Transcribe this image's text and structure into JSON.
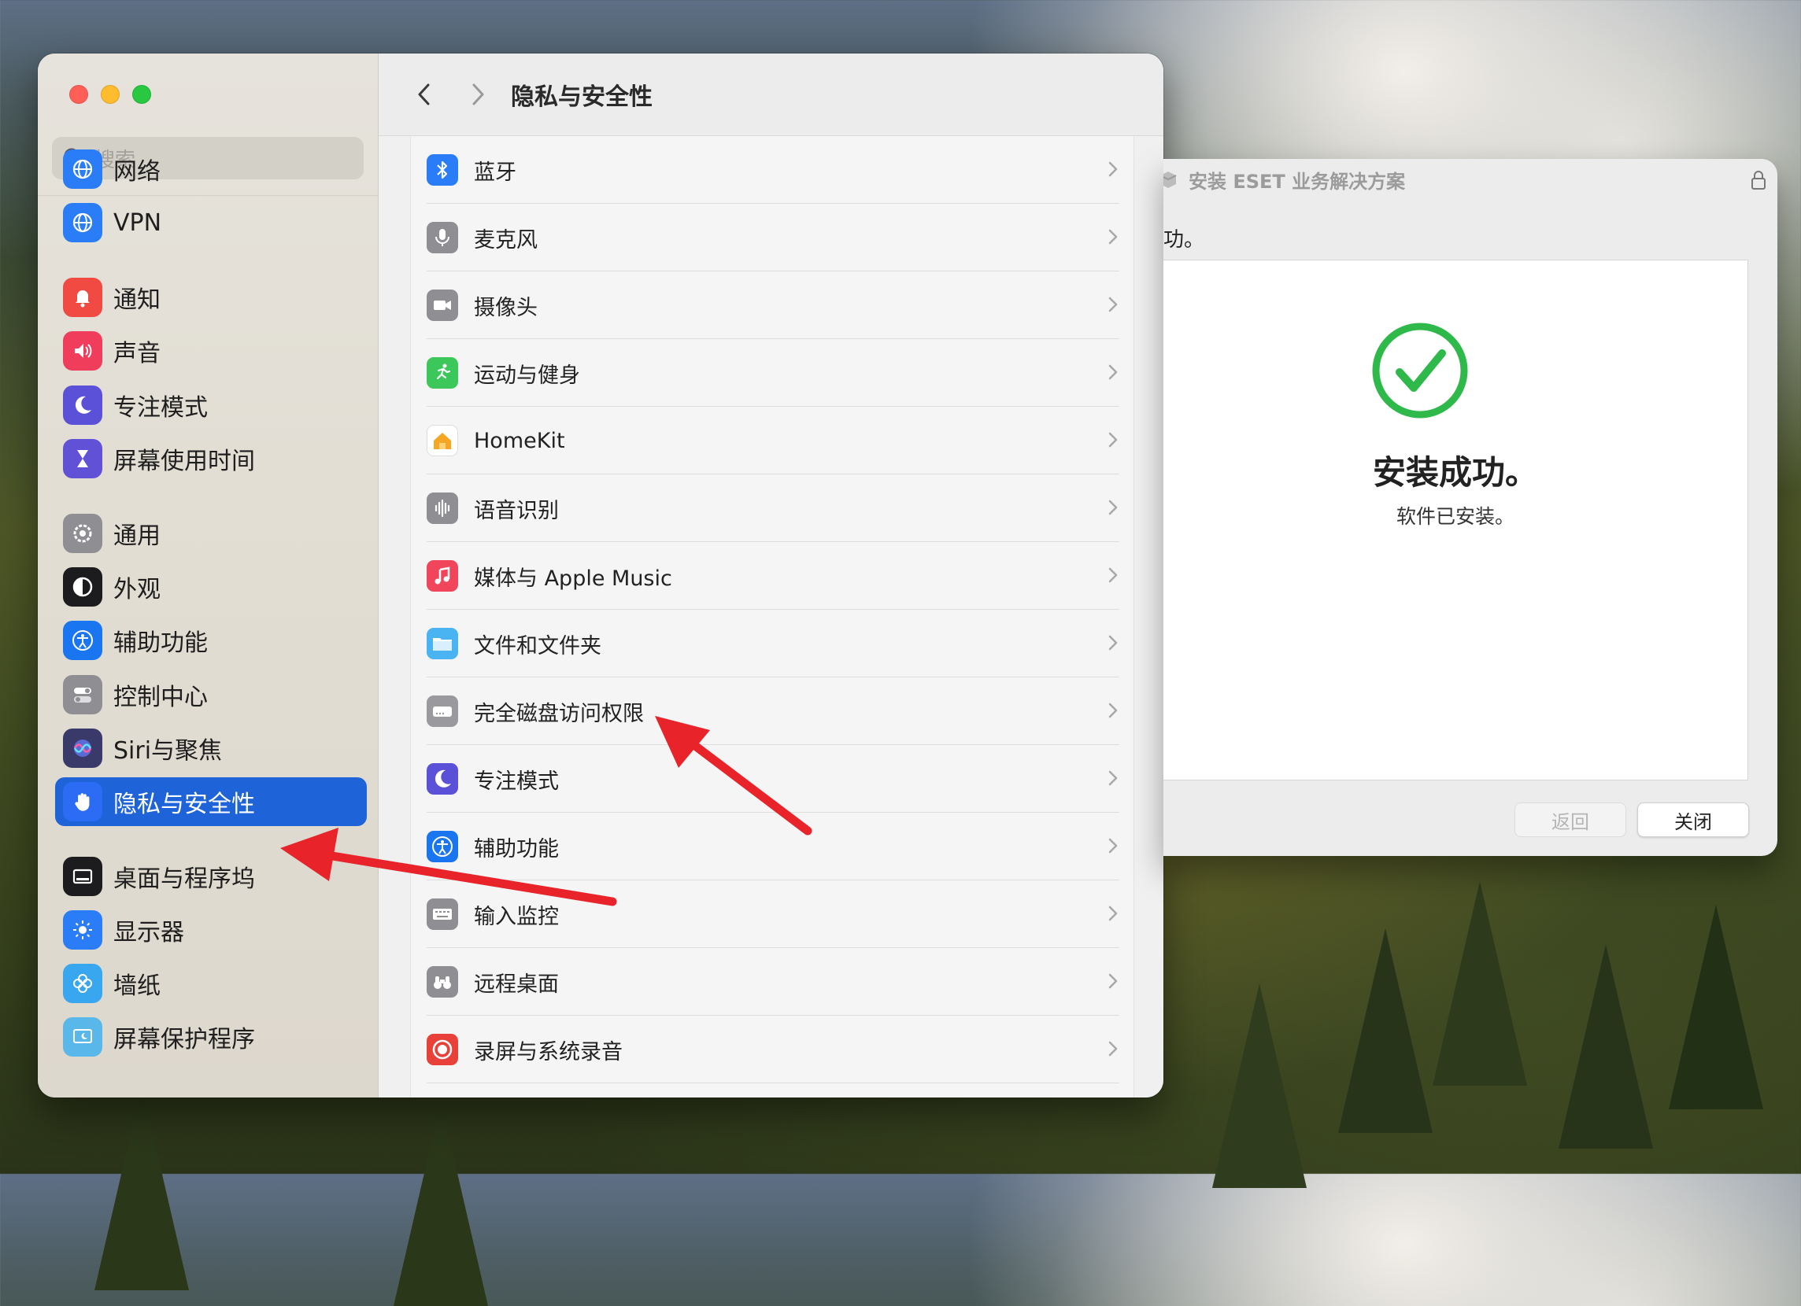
{
  "settings": {
    "search_placeholder": "搜索",
    "title": "隐私与安全性",
    "sidebar": [
      {
        "label": "网络",
        "icon": "globe-icon",
        "color": "#2a7cf7"
      },
      {
        "label": "VPN",
        "icon": "globe-vpn-icon",
        "color": "#2a7cf7"
      },
      {
        "label": "通知",
        "icon": "bell-icon",
        "color": "#f04a43"
      },
      {
        "label": "声音",
        "icon": "speaker-icon",
        "color": "#ef3d5b"
      },
      {
        "label": "专注模式",
        "icon": "moon-icon",
        "color": "#5b51d8"
      },
      {
        "label": "屏幕使用时间",
        "icon": "hourglass-icon",
        "color": "#6151d6"
      },
      {
        "label": "通用",
        "icon": "gear-icon",
        "color": "#8e8e93"
      },
      {
        "label": "外观",
        "icon": "appearance-icon",
        "color": "#1c1c1e"
      },
      {
        "label": "辅助功能",
        "icon": "accessibility-icon",
        "color": "#1a75f0"
      },
      {
        "label": "控制中心",
        "icon": "toggles-icon",
        "color": "#8e8e93"
      },
      {
        "label": "Siri与聚焦",
        "icon": "siri-icon",
        "color": "#3a3a6a"
      },
      {
        "label": "隐私与安全性",
        "icon": "hand-icon",
        "color": "#2c6cf5"
      },
      {
        "label": "桌面与程序坞",
        "icon": "dock-icon",
        "color": "#1c1c1e"
      },
      {
        "label": "显示器",
        "icon": "sun-icon",
        "color": "#2a7cf7"
      },
      {
        "label": "墙纸",
        "icon": "flower-icon",
        "color": "#39a7f0"
      },
      {
        "label": "屏幕保护程序",
        "icon": "screensaver-icon",
        "color": "#5ab7ea"
      }
    ],
    "rows": [
      {
        "label": "蓝牙",
        "icon": "bluetooth-icon",
        "color": "#2a7cf7"
      },
      {
        "label": "麦克风",
        "icon": "microphone-icon",
        "color": "#8e8e93"
      },
      {
        "label": "摄像头",
        "icon": "camera-icon",
        "color": "#8e8e93"
      },
      {
        "label": "运动与健身",
        "icon": "running-icon",
        "color": "#3cc75a"
      },
      {
        "label": "HomeKit",
        "icon": "home-icon",
        "color": "#ffffff"
      },
      {
        "label": "语音识别",
        "icon": "waveform-icon",
        "color": "#8e8e93"
      },
      {
        "label": "媒体与 Apple Music",
        "icon": "music-icon",
        "color": "#f0455a"
      },
      {
        "label": "文件和文件夹",
        "icon": "folder-icon",
        "color": "#4ab3f2"
      },
      {
        "label": "完全磁盘访问权限",
        "icon": "disk-icon",
        "color": "#9a9a9e"
      },
      {
        "label": "专注模式",
        "icon": "moon-icon",
        "color": "#5b51d8"
      },
      {
        "label": "辅助功能",
        "icon": "accessibility-icon",
        "color": "#1a75f0"
      },
      {
        "label": "输入监控",
        "icon": "keyboard-icon",
        "color": "#8e8e93"
      },
      {
        "label": "远程桌面",
        "icon": "binoculars-icon",
        "color": "#8e8e93"
      },
      {
        "label": "录屏与系统录音",
        "icon": "record-icon",
        "color": "#e8413a"
      }
    ]
  },
  "installer": {
    "title": "安装 ESET 业务解决方案",
    "partial_text": "功。",
    "heading": "安装成功。",
    "subtext": "软件已安装。",
    "back_label": "返回",
    "close_label": "关闭",
    "check_color": "#2fb94a"
  }
}
